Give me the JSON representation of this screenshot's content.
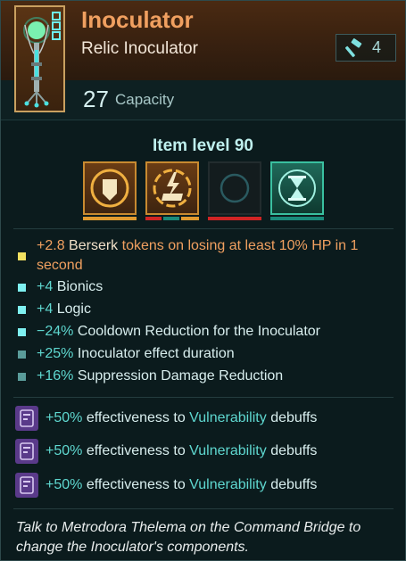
{
  "item": {
    "name": "Inoculator",
    "type": "Relic Inoculator",
    "gear_score": "4",
    "capacity_value": "27",
    "capacity_label": "Capacity",
    "item_level": "Item level 90"
  },
  "colors": {
    "title": "#f0a060",
    "accent_teal": "#5fd8d0",
    "mod_red": "#d02424",
    "mod_teal": "#1a8a7a",
    "mod_gold": "#e09a30"
  },
  "mods": [
    {
      "icon": "shield-mod-icon"
    },
    {
      "icon": "lightning-mod-icon"
    },
    {
      "icon": "empty-slot-icon"
    },
    {
      "icon": "hourglass-mod-icon"
    }
  ],
  "stats": [
    {
      "value": "+2.8",
      "keyword": "Berserk",
      "rest": "tokens on losing at least 10% HP in 1 second",
      "bullet_color": "#f2e060"
    },
    {
      "value": "+4",
      "rest": "Bionics",
      "bullet_color": "#7ef0f0"
    },
    {
      "value": "+4",
      "rest": "Logic",
      "bullet_color": "#7ef0f0"
    },
    {
      "value": "−24%",
      "rest": "Cooldown Reduction for the Inoculator",
      "bullet_color": "#7ef0f0"
    },
    {
      "value": "+25%",
      "rest": "Inoculator effect duration",
      "bullet_color": "#5a9c9a"
    },
    {
      "value": "+16%",
      "rest": "Suppression Damage Reduction",
      "bullet_color": "#5a9c9a"
    }
  ],
  "effects": [
    {
      "pct": "+50%",
      "pre": "effectiveness to",
      "kw": "Vulnerability",
      "post": "debuffs"
    },
    {
      "pct": "+50%",
      "pre": "effectiveness to",
      "kw": "Vulnerability",
      "post": "debuffs"
    },
    {
      "pct": "+50%",
      "pre": "effectiveness to",
      "kw": "Vulnerability",
      "post": "debuffs"
    }
  ],
  "footer": "Talk to Metrodora Thelema on the Command Bridge to change the Inoculator's components."
}
